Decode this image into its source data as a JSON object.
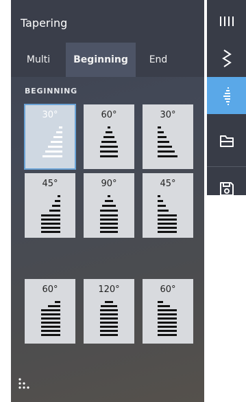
{
  "panel": {
    "title": "Tapering"
  },
  "tabs": [
    {
      "label": "Multi"
    },
    {
      "label": "Beginning",
      "active": true
    },
    {
      "label": "End"
    }
  ],
  "section_label": "BEGINNING",
  "tiles": [
    {
      "label": "30°",
      "selected": true
    },
    {
      "label": "60°"
    },
    {
      "label": "30°"
    },
    {
      "label": "45°"
    },
    {
      "label": "90°"
    },
    {
      "label": "45°"
    },
    {
      "label": "60°"
    },
    {
      "label": "120°"
    },
    {
      "label": "60°"
    }
  ],
  "sidebar": {
    "items": [
      {
        "icon": "stitch-bars-icon"
      },
      {
        "icon": "zigzag-stitch-icon"
      },
      {
        "icon": "tapering-icon",
        "active": true
      },
      {
        "icon": "folder-icon"
      },
      {
        "icon": "save-icon"
      }
    ]
  },
  "colors": {
    "accent": "#5aa8e8",
    "selected_outline": "#6aa3d6",
    "panel_dark": "#3a3e4a",
    "tile_bg": "#d8dade"
  }
}
